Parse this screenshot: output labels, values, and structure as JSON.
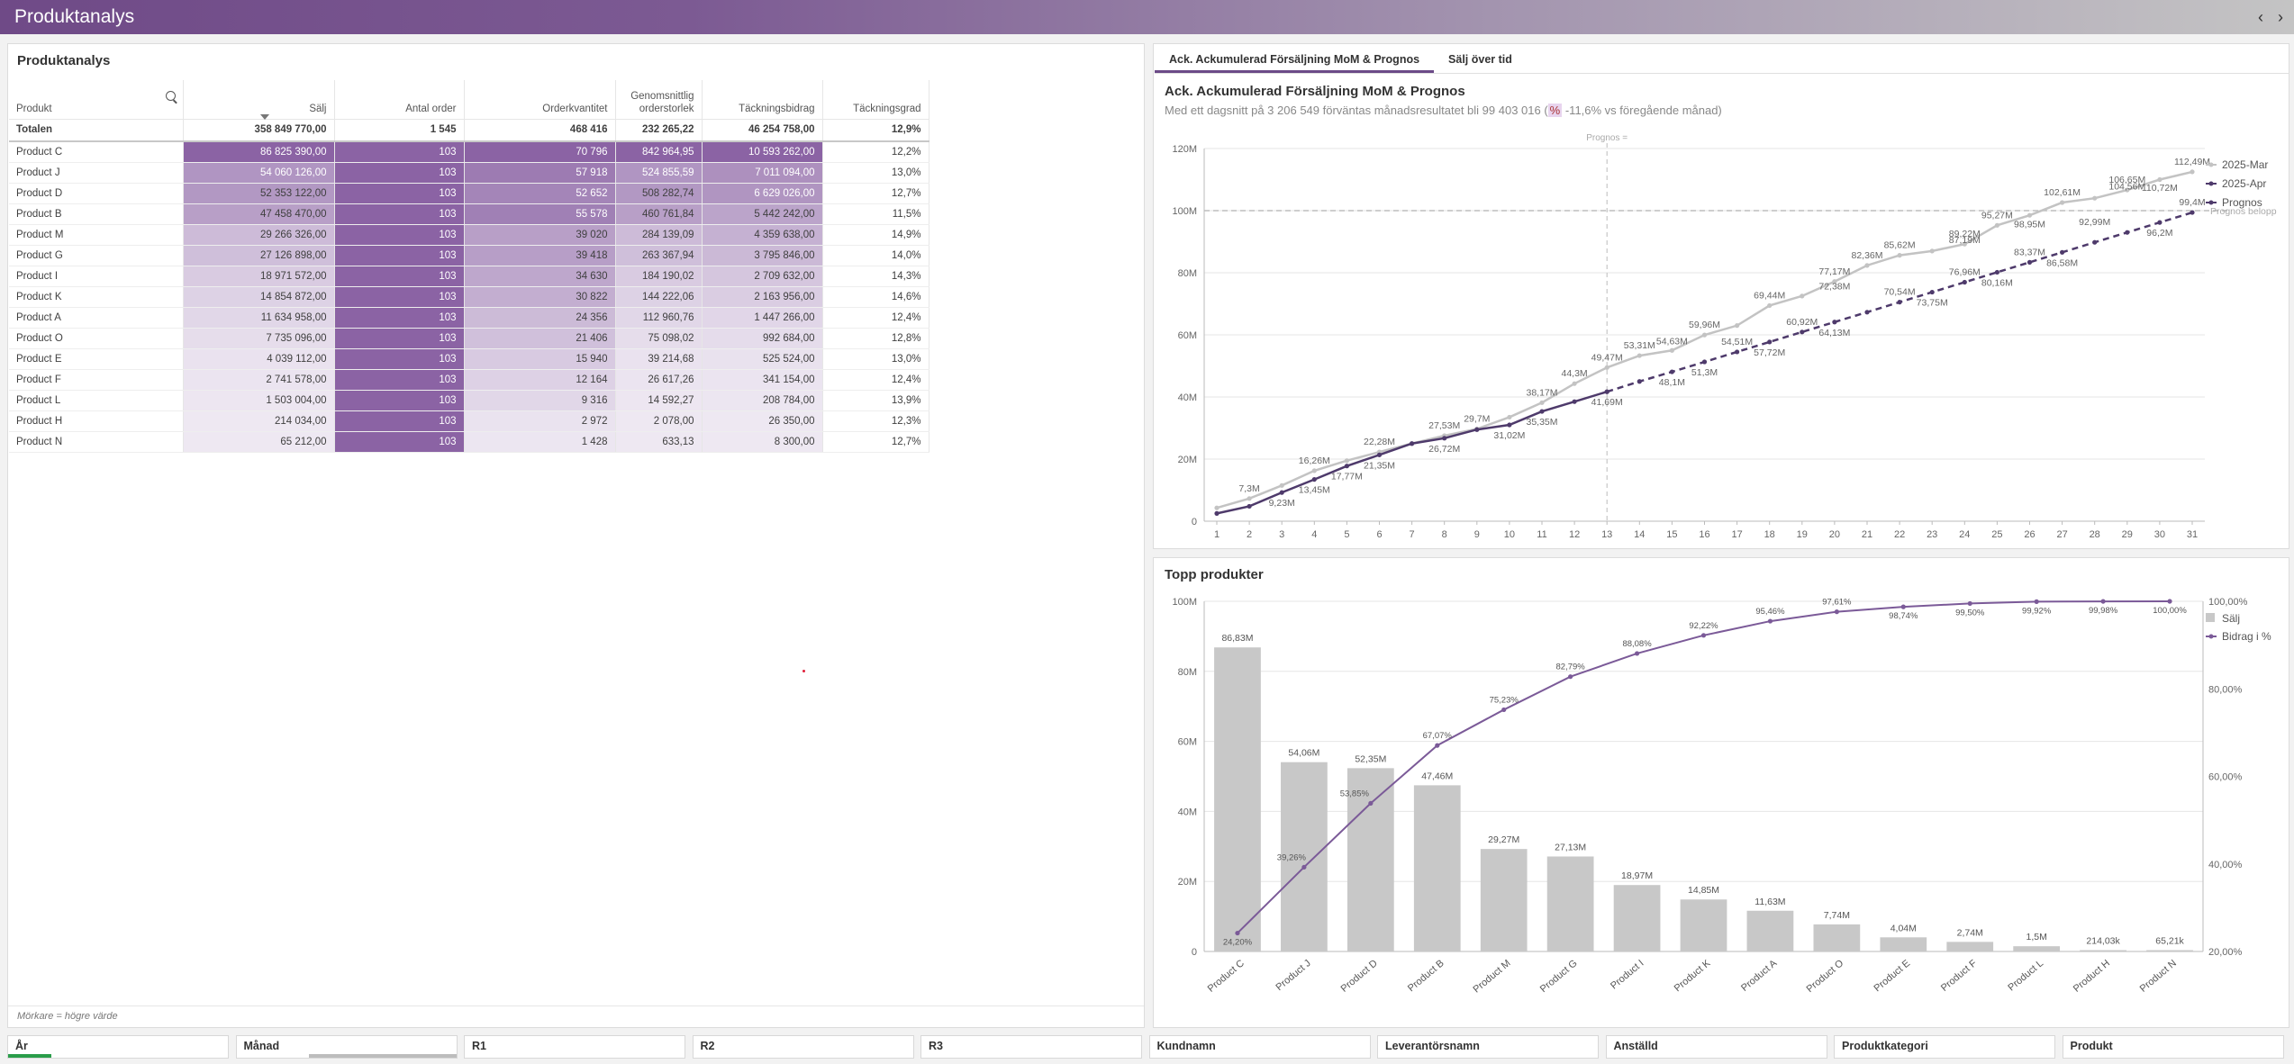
{
  "app": {
    "title": "Produktanalys",
    "nav_prev": "‹",
    "nav_next": "›"
  },
  "table_panel": {
    "title": "Produktanalys",
    "headers": [
      "Produkt",
      "Sälj",
      "Antal order",
      "Orderkvantitet",
      "Genomsnittlig orderstorlek",
      "Täckningsbidrag",
      "Täckningsgrad"
    ],
    "total": [
      "Totalen",
      "358 849 770,00",
      "1 545",
      "468 416",
      "232 265,22",
      "46 254 758,00",
      "12,9%"
    ],
    "rows": [
      [
        "Product C",
        "86 825 390,00",
        "103",
        "70 796",
        "842 964,95",
        "10 593 262,00",
        "12,2%"
      ],
      [
        "Product J",
        "54 060 126,00",
        "103",
        "57 918",
        "524 855,59",
        "7 011 094,00",
        "13,0%"
      ],
      [
        "Product D",
        "52 353 122,00",
        "103",
        "52 652",
        "508 282,74",
        "6 629 026,00",
        "12,7%"
      ],
      [
        "Product B",
        "47 458 470,00",
        "103",
        "55 578",
        "460 761,84",
        "5 442 242,00",
        "11,5%"
      ],
      [
        "Product M",
        "29 266 326,00",
        "103",
        "39 020",
        "284 139,09",
        "4 359 638,00",
        "14,9%"
      ],
      [
        "Product G",
        "27 126 898,00",
        "103",
        "39 418",
        "263 367,94",
        "3 795 846,00",
        "14,0%"
      ],
      [
        "Product I",
        "18 971 572,00",
        "103",
        "34 630",
        "184 190,02",
        "2 709 632,00",
        "14,3%"
      ],
      [
        "Product K",
        "14 854 872,00",
        "103",
        "30 822",
        "144 222,06",
        "2 163 956,00",
        "14,6%"
      ],
      [
        "Product A",
        "11 634 958,00",
        "103",
        "24 356",
        "112 960,76",
        "1 447 266,00",
        "12,4%"
      ],
      [
        "Product O",
        "7 735 096,00",
        "103",
        "21 406",
        "75 098,02",
        "992 684,00",
        "12,8%"
      ],
      [
        "Product E",
        "4 039 112,00",
        "103",
        "15 940",
        "39 214,68",
        "525 524,00",
        "13,0%"
      ],
      [
        "Product F",
        "2 741 578,00",
        "103",
        "12 164",
        "26 617,26",
        "341 154,00",
        "12,4%"
      ],
      [
        "Product L",
        "1 503 004,00",
        "103",
        "9 316",
        "14 592,27",
        "208 784,00",
        "13,9%"
      ],
      [
        "Product H",
        "214 034,00",
        "103",
        "2 972",
        "2 078,00",
        "26 350,00",
        "12,3%"
      ],
      [
        "Product N",
        "65 212,00",
        "103",
        "1 428",
        "633,13",
        "8 300,00",
        "12,7%"
      ]
    ],
    "footnote": "Mörkare = högre värde"
  },
  "tabs": [
    "Ack. Ackumulerad Försäljning MoM & Prognos",
    "Sälj över tid"
  ],
  "chart_titles": {
    "cumulative_title": "Ack. Ackumulerad Försäljning MoM & Prognos",
    "cumulative_sub_a": "Med ett dagsnitt på 3 206 549 förväntas månadsresultatet bli 99 403 016 (",
    "cumulative_sub_pct": "%",
    "cumulative_sub_b": " -11,6% vs föregående månad)",
    "top_title": "Topp produkter"
  },
  "colors": {
    "purple": "#6b4a87",
    "dark": "#4e3a6b",
    "grey": "#c8c8c8",
    "accent_green": "#2a9d4a"
  },
  "chart_data": [
    {
      "type": "line",
      "title": "Ack. Ackumulerad Försäljning MoM & Prognos",
      "x": [
        1,
        2,
        3,
        4,
        5,
        6,
        7,
        8,
        9,
        10,
        11,
        12,
        13,
        14,
        15,
        16,
        17,
        18,
        19,
        20,
        21,
        22,
        23,
        24,
        25,
        26,
        27,
        28,
        29,
        30,
        31
      ],
      "ylim": [
        0,
        120
      ],
      "yticks": [
        "0",
        "20M",
        "40M",
        "60M",
        "80M",
        "100M",
        "120M"
      ],
      "grid": true,
      "legend_position": "right",
      "reference_line": {
        "y": 100,
        "label": "Prognos belopp"
      },
      "vertical_marker": {
        "x": 13,
        "label": "Prognos ="
      },
      "series": [
        {
          "name": "2025-Mar",
          "values": [
            4.3,
            7.3,
            11.5,
            16.26,
            19.5,
            22.28,
            25,
            27.53,
            29.7,
            33.5,
            38.17,
            44.3,
            49.47,
            53.31,
            55,
            59.96,
            63,
            69.44,
            72.5,
            77.17,
            82.36,
            85.62,
            87,
            89.22,
            95.27,
            98.5,
            102.61,
            104,
            106.65,
            110,
            112.49
          ]
        },
        {
          "name": "2025-Apr",
          "values": [
            2.5,
            4.8,
            9.23,
            13.45,
            17.77,
            21.35,
            25,
            26.72,
            29.5,
            31.02,
            35.35,
            38.5,
            41.69
          ]
        },
        {
          "name": "Prognos",
          "values": [
            null,
            null,
            null,
            null,
            null,
            null,
            null,
            null,
            null,
            null,
            null,
            null,
            41.69,
            45,
            48.1,
            51.3,
            54.51,
            57.72,
            60.92,
            64.13,
            67.3,
            70.54,
            73.75,
            76.96,
            80.16,
            83.37,
            86.58,
            89.8,
            92.99,
            96.2,
            99.4
          ]
        }
      ],
      "point_labels": [
        {
          "series": "2025-Mar",
          "x": 2,
          "text": "7,3M",
          "pos": "above"
        },
        {
          "series": "2025-Mar",
          "x": 4,
          "text": "16,26M",
          "pos": "above"
        },
        {
          "series": "2025-Mar",
          "x": 6,
          "text": "22,28M",
          "pos": "above"
        },
        {
          "series": "2025-Mar",
          "x": 8,
          "text": "27,53M",
          "pos": "above"
        },
        {
          "series": "2025-Mar",
          "x": 9,
          "text": "29,7M",
          "pos": "above"
        },
        {
          "series": "2025-Mar",
          "x": 11,
          "text": "38,17M",
          "pos": "above"
        },
        {
          "series": "2025-Mar",
          "x": 12,
          "text": "44,3M",
          "pos": "above"
        },
        {
          "series": "2025-Mar",
          "x": 13,
          "text": "49,47M",
          "pos": "above"
        },
        {
          "series": "2025-Mar",
          "x": 14,
          "text": "53,31M",
          "pos": "above"
        },
        {
          "series": "2025-Mar",
          "x": 16,
          "text": "59,96M",
          "pos": "above"
        },
        {
          "series": "2025-Mar",
          "x": 18,
          "text": "69,44M",
          "pos": "above"
        },
        {
          "series": "2025-Mar",
          "x": 20,
          "text": "77,17M",
          "pos": "above"
        },
        {
          "series": "2025-Mar",
          "x": 21,
          "text": "82,36M",
          "pos": "above"
        },
        {
          "series": "2025-Mar",
          "x": 22,
          "text": "85,62M",
          "pos": "above"
        },
        {
          "series": "2025-Mar",
          "x": 24,
          "text": "89,22M",
          "pos": "above"
        },
        {
          "series": "2025-Mar",
          "x": 25,
          "text": "95,27M",
          "pos": "above"
        },
        {
          "series": "2025-Mar",
          "x": 27,
          "text": "102,61M",
          "pos": "above"
        },
        {
          "series": "2025-Mar",
          "x": 29,
          "text": "106,65M",
          "pos": "above"
        },
        {
          "series": "2025-Mar",
          "x": 31,
          "text": "112,49M",
          "pos": "above"
        },
        {
          "series": "2025-Apr",
          "x": 3,
          "text": "9,23M",
          "pos": "below"
        },
        {
          "series": "2025-Apr",
          "x": 4,
          "text": "13,45M",
          "pos": "below"
        },
        {
          "series": "2025-Apr",
          "x": 5,
          "text": "17,77M",
          "pos": "below"
        },
        {
          "series": "2025-Apr",
          "x": 6,
          "text": "21,35M",
          "pos": "below"
        },
        {
          "series": "2025-Apr",
          "x": 8,
          "text": "26,72M",
          "pos": "below"
        },
        {
          "series": "2025-Apr",
          "x": 10,
          "text": "31,02M",
          "pos": "below"
        },
        {
          "series": "2025-Apr",
          "x": 11,
          "text": "35,35M",
          "pos": "below"
        },
        {
          "series": "2025-Apr",
          "x": 13,
          "text": "41,69M",
          "pos": "below"
        },
        {
          "series": "Prognos",
          "x": 15,
          "text": "48,1M",
          "pos": "below"
        },
        {
          "series": "Prognos",
          "x": 16,
          "text": "51,3M",
          "pos": "below"
        },
        {
          "series": "Prognos",
          "x": 15,
          "text": "54,63M",
          "pos": "above"
        },
        {
          "series": "Prognos",
          "x": 17,
          "text": "54,51M",
          "pos": "above"
        },
        {
          "series": "Prognos",
          "x": 18,
          "text": "57,72M",
          "pos": "below"
        },
        {
          "series": "Prognos",
          "x": 19,
          "text": "60,92M",
          "pos": "above"
        },
        {
          "series": "Prognos",
          "x": 20,
          "text": "64,13M",
          "pos": "below"
        },
        {
          "series": "Prognos",
          "x": 20,
          "text": "72,38M",
          "pos": "above"
        },
        {
          "series": "Prognos",
          "x": 22,
          "text": "70,54M",
          "pos": "above"
        },
        {
          "series": "Prognos",
          "x": 23,
          "text": "73,75M",
          "pos": "below"
        },
        {
          "series": "Prognos",
          "x": 24,
          "text": "76,96M",
          "pos": "above"
        },
        {
          "series": "Prognos",
          "x": 24,
          "text": "87,19M",
          "pos": "above"
        },
        {
          "series": "Prognos",
          "x": 25,
          "text": "80,16M",
          "pos": "below"
        },
        {
          "series": "Prognos",
          "x": 26,
          "text": "83,37M",
          "pos": "above"
        },
        {
          "series": "Prognos",
          "x": 27,
          "text": "86,58M",
          "pos": "below"
        },
        {
          "series": "Prognos",
          "x": 26,
          "text": "98,95M",
          "pos": "below"
        },
        {
          "series": "Prognos",
          "x": 28,
          "text": "92,99M",
          "pos": "above"
        },
        {
          "series": "Prognos",
          "x": 29,
          "text": "104,56M",
          "pos": "above"
        },
        {
          "series": "Prognos",
          "x": 30,
          "text": "96,2M",
          "pos": "below"
        },
        {
          "series": "Prognos",
          "x": 30,
          "text": "110,72M",
          "pos": "below"
        },
        {
          "series": "Prognos",
          "x": 31,
          "text": "99,4M",
          "pos": "above"
        }
      ]
    },
    {
      "type": "bar",
      "title": "Topp produkter",
      "categories": [
        "Product C",
        "Product J",
        "Product D",
        "Product B",
        "Product M",
        "Product G",
        "Product I",
        "Product K",
        "Product A",
        "Product O",
        "Product E",
        "Product F",
        "Product L",
        "Product H",
        "Product N"
      ],
      "ylim": [
        0,
        100
      ],
      "yticks": [
        "0",
        "20M",
        "40M",
        "60M",
        "80M",
        "100M"
      ],
      "y2lim": [
        20,
        100
      ],
      "y2ticks": [
        "20,00%",
        "40,00%",
        "60,00%",
        "80,00%",
        "100,00%"
      ],
      "legend_position": "right",
      "series": [
        {
          "name": "Sälj",
          "values": [
            86.83,
            54.06,
            52.35,
            47.46,
            29.27,
            27.13,
            18.97,
            14.85,
            11.63,
            7.74,
            4.04,
            2.74,
            1.5,
            0.214,
            0.065
          ],
          "labels": [
            "86,83M",
            "54,06M",
            "52,35M",
            "47,46M",
            "29,27M",
            "27,13M",
            "18,97M",
            "14,85M",
            "11,63M",
            "7,74M",
            "4,04M",
            "2,74M",
            "1,5M",
            "214,03k",
            "65,21k"
          ]
        },
        {
          "name": "Bidrag i %",
          "values": [
            24.2,
            39.26,
            53.85,
            67.07,
            75.23,
            82.79,
            88.08,
            92.22,
            95.46,
            97.61,
            98.74,
            99.5,
            99.92,
            99.98,
            100
          ],
          "labels": [
            "24,20%",
            "39,26%",
            "53,85%",
            "67,07%",
            "75,23%",
            "82,79%",
            "88,08%",
            "92,22%",
            "95,46%",
            "97,61%",
            "98,74%",
            "99,50%",
            "99,92%",
            "99,98%",
            "100,00%"
          ]
        }
      ]
    }
  ],
  "filters": [
    {
      "label": "År",
      "sel": "green"
    },
    {
      "label": "Månad",
      "sel": "grey"
    },
    {
      "label": "R1"
    },
    {
      "label": "R2"
    },
    {
      "label": "R3"
    },
    {
      "label": "Kundnamn"
    },
    {
      "label": "Leverantörsnamn"
    },
    {
      "label": "Anställd"
    },
    {
      "label": "Produktkategori"
    },
    {
      "label": "Produkt"
    }
  ]
}
